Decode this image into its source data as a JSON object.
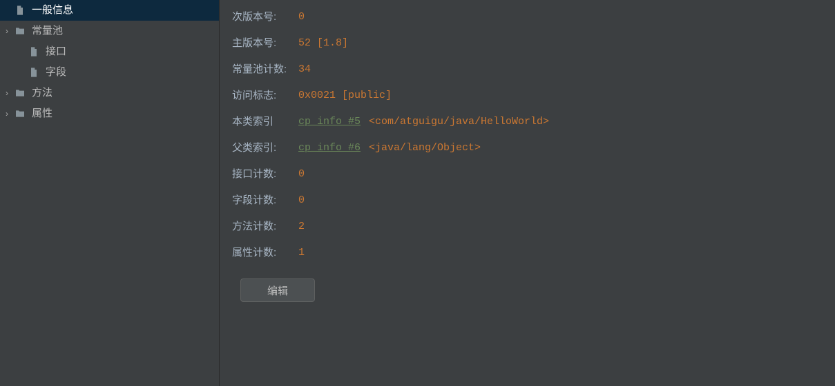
{
  "sidebar": {
    "items": [
      {
        "label": "一般信息",
        "icon": "file",
        "depth": 0,
        "expandable": false,
        "selected": true
      },
      {
        "label": "常量池",
        "icon": "folder",
        "depth": 0,
        "expandable": true,
        "selected": false
      },
      {
        "label": "接口",
        "icon": "file",
        "depth": 1,
        "expandable": false,
        "selected": false
      },
      {
        "label": "字段",
        "icon": "file",
        "depth": 1,
        "expandable": false,
        "selected": false
      },
      {
        "label": "方法",
        "icon": "folder",
        "depth": 0,
        "expandable": true,
        "selected": false
      },
      {
        "label": "属性",
        "icon": "folder",
        "depth": 0,
        "expandable": true,
        "selected": false
      }
    ]
  },
  "info": {
    "minor_version": {
      "key": "次版本号:",
      "value": "0"
    },
    "major_version": {
      "key": "主版本号:",
      "value": "52 [1.8]"
    },
    "constant_pool_count": {
      "key": "常量池计数:",
      "value": "34"
    },
    "access_flags": {
      "key": "访问标志:",
      "value": "0x0021 [public]"
    },
    "this_class": {
      "key": "本类索引",
      "link": "cp_info #5",
      "note": "<com/atguigu/java/HelloWorld>"
    },
    "super_class": {
      "key": "父类索引:",
      "link": "cp_info #6",
      "note": "<java/lang/Object>"
    },
    "interfaces_count": {
      "key": "接口计数:",
      "value": "0"
    },
    "fields_count": {
      "key": "字段计数:",
      "value": "0"
    },
    "methods_count": {
      "key": "方法计数:",
      "value": "2"
    },
    "attributes_count": {
      "key": "属性计数:",
      "value": "1"
    }
  },
  "buttons": {
    "edit": "编辑"
  }
}
